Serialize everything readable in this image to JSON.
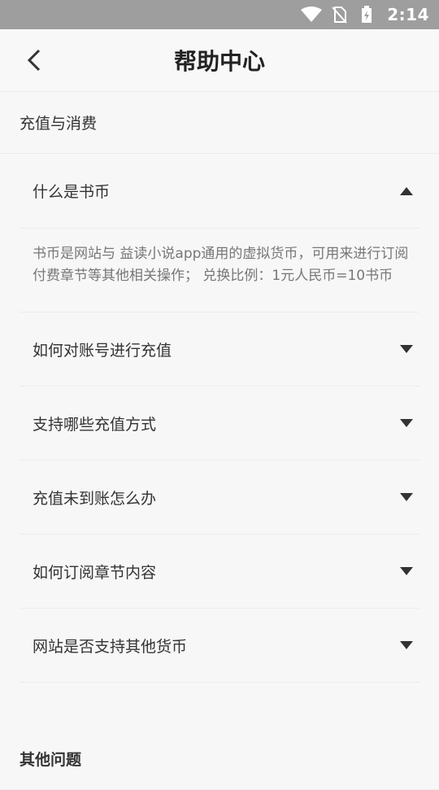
{
  "status_bar": {
    "time": "2:14",
    "icons": [
      "wifi-icon",
      "no-sim-icon",
      "battery-charging-icon"
    ]
  },
  "header": {
    "title": "帮助中心",
    "back_icon": "chevron-left-icon"
  },
  "sections": [
    {
      "title": "充值与消费",
      "items": [
        {
          "question": "什么是书币",
          "expanded": true,
          "answer": "书币是网站与 益读小说app通用的虚拟货币，可用来进行订阅付费章节等其他相关操作； 兑换比例：1元人民币=10书币"
        },
        {
          "question": "如何对账号进行充值",
          "expanded": false
        },
        {
          "question": "支持哪些充值方式",
          "expanded": false
        },
        {
          "question": "充值未到账怎么办",
          "expanded": false
        },
        {
          "question": "如何订阅章节内容",
          "expanded": false
        },
        {
          "question": "网站是否支持其他货币",
          "expanded": false
        }
      ]
    },
    {
      "title": "其他问题"
    }
  ],
  "colors": {
    "status_bar": "#9e9e9e",
    "background": "#f7f7f7",
    "text": "#333333",
    "answer_text": "#777777"
  }
}
